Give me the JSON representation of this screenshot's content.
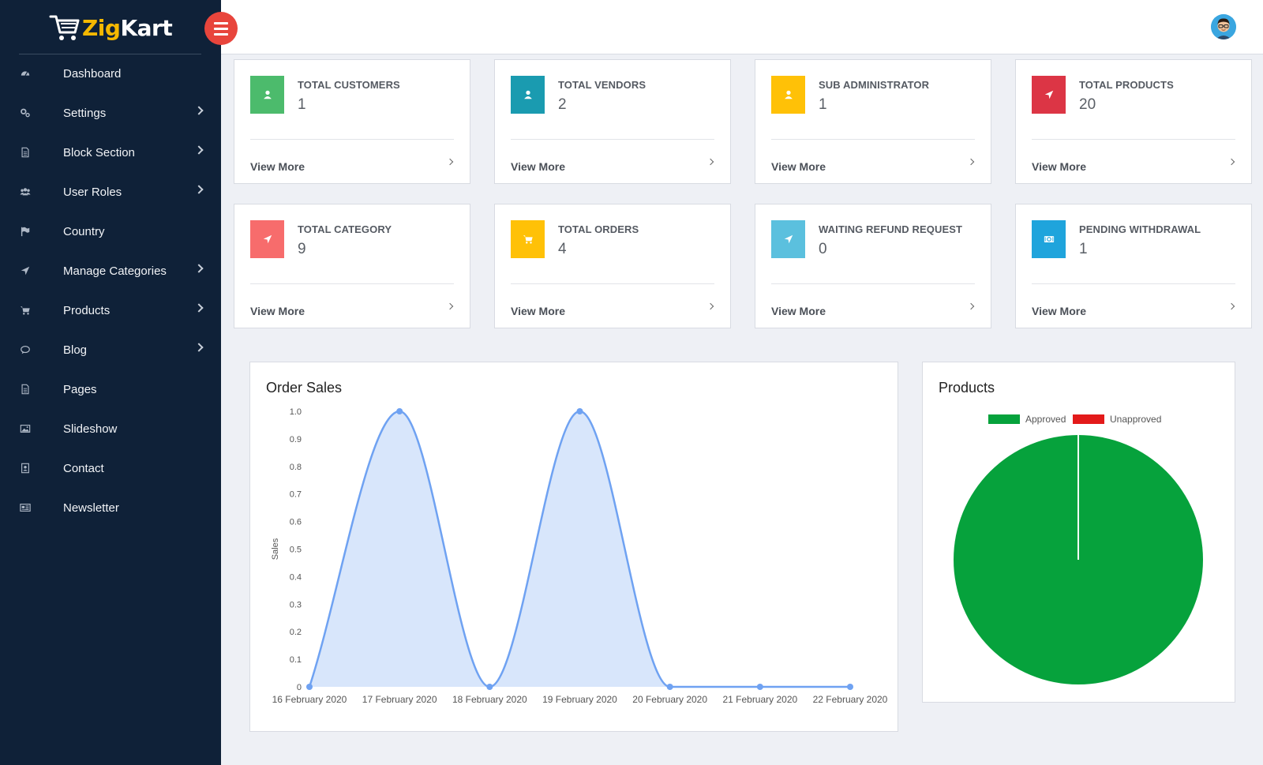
{
  "brand": {
    "part1": "Zig",
    "part2": "Kart"
  },
  "sidebar": {
    "items": [
      {
        "label": "Dashboard",
        "icon": "dashboard-icon",
        "has_submenu": false
      },
      {
        "label": "Settings",
        "icon": "gears-icon",
        "has_submenu": true
      },
      {
        "label": "Block Section",
        "icon": "document-icon",
        "has_submenu": true
      },
      {
        "label": "User Roles",
        "icon": "users-icon",
        "has_submenu": true
      },
      {
        "label": "Country",
        "icon": "flag-icon",
        "has_submenu": false
      },
      {
        "label": "Manage Categories",
        "icon": "location-arrow-icon",
        "has_submenu": true
      },
      {
        "label": "Products",
        "icon": "cart-icon",
        "has_submenu": true
      },
      {
        "label": "Blog",
        "icon": "comment-icon",
        "has_submenu": true
      },
      {
        "label": "Pages",
        "icon": "page-icon",
        "has_submenu": false
      },
      {
        "label": "Slideshow",
        "icon": "image-icon",
        "has_submenu": false
      },
      {
        "label": "Contact",
        "icon": "contact-card-icon",
        "has_submenu": false
      },
      {
        "label": "Newsletter",
        "icon": "newspaper-icon",
        "has_submenu": false
      }
    ]
  },
  "cards": [
    {
      "title": "TOTAL CUSTOMERS",
      "value": "1",
      "link": "View More",
      "color": "#4cbb6c",
      "icon": "user-icon"
    },
    {
      "title": "TOTAL VENDORS",
      "value": "2",
      "link": "View More",
      "color": "#1a9bb0",
      "icon": "user-icon"
    },
    {
      "title": "SUB ADMINISTRATOR",
      "value": "1",
      "link": "View More",
      "color": "#ffc107",
      "icon": "user-icon"
    },
    {
      "title": "TOTAL PRODUCTS",
      "value": "20",
      "link": "View More",
      "color": "#dc3545",
      "icon": "location-arrow-icon"
    },
    {
      "title": "TOTAL CATEGORY",
      "value": "9",
      "link": "View More",
      "color": "#f76c6c",
      "icon": "location-arrow-icon"
    },
    {
      "title": "TOTAL ORDERS",
      "value": "4",
      "link": "View More",
      "color": "#ffc107",
      "icon": "cart-icon"
    },
    {
      "title": "WAITING REFUND REQUEST",
      "value": "0",
      "link": "View More",
      "color": "#5bc0de",
      "icon": "location-arrow-icon"
    },
    {
      "title": "PENDING WITHDRAWAL",
      "value": "1",
      "link": "View More",
      "color": "#1fa4dc",
      "icon": "money-icon"
    }
  ],
  "order_panel": {
    "title": "Order Sales"
  },
  "products_panel": {
    "title": "Products"
  },
  "chart_data": [
    {
      "type": "area",
      "title": "Order Sales",
      "xlabel": "",
      "ylabel": "Sales",
      "categories": [
        "16 February 2020",
        "17 February 2020",
        "18 February 2020",
        "19 February 2020",
        "20 February 2020",
        "21 February 2020",
        "22 February 2020"
      ],
      "series": [
        {
          "values": [
            0,
            1,
            0,
            1,
            0,
            0,
            0
          ]
        }
      ],
      "ylim": [
        0,
        1
      ],
      "yticks": [
        "0",
        "0.1",
        "0.2",
        "0.3",
        "0.4",
        "0.5",
        "0.6",
        "0.7",
        "0.8",
        "0.9",
        "1.0"
      ],
      "color": "#6fa2f2",
      "fill": "#d8e6fb",
      "grid": false
    },
    {
      "type": "pie",
      "title": "Products",
      "labels": [
        "Approved",
        "Unapproved"
      ],
      "values": [
        20,
        0
      ],
      "colors": [
        "#06a23c",
        "#e31a1a"
      ],
      "legend": "top"
    }
  ]
}
